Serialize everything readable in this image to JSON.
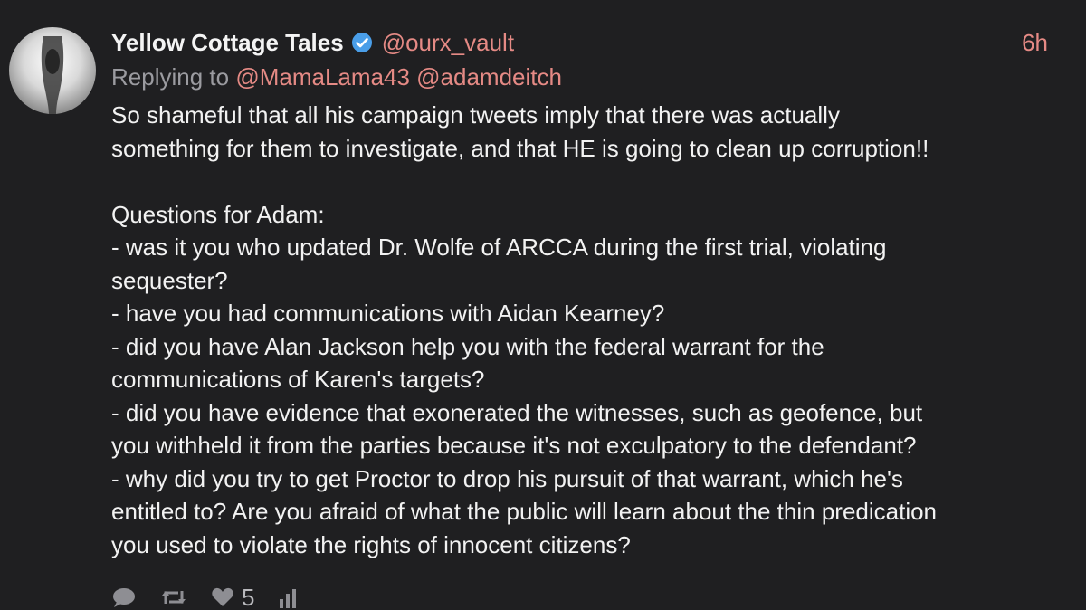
{
  "tweet": {
    "display_name": "Yellow Cottage Tales",
    "handle": "@ourx_vault",
    "time": "6h",
    "replying_to_label": "Replying to",
    "replying_to": [
      "@MamaLama43",
      "@adamdeitch"
    ],
    "lines": [
      "So shameful that all his campaign tweets imply that there was actually",
      "something for them to investigate, and that HE is going to clean up corruption!!",
      "",
      "Questions for Adam:",
      "- was it you who updated Dr. Wolfe of ARCCA during the first trial, violating",
      "sequester?",
      "- have you had communications with Aidan Kearney?",
      "- did you have Alan Jackson help you with the federal warrant for the",
      "communications of Karen's targets?",
      "- did you have evidence that exonerated the witnesses, such as geofence, but",
      "you withheld it from the parties because it's not exculpatory to the defendant?",
      "- why did you try to get Proctor to drop his pursuit of that warrant, which he's",
      "entitled to? Are you afraid of what the public will learn about the thin predication",
      "you used to violate the rights of innocent citizens?"
    ],
    "like_count": "5"
  },
  "icons": {
    "verified": "verified-badge-icon",
    "reply": "reply-icon",
    "retweet": "retweet-icon",
    "like": "heart-icon",
    "stats": "stats-icon"
  },
  "colors": {
    "background": "#1f1f21",
    "accent": "#e58a85",
    "verified": "#4a9ee8",
    "muted": "#9b9ba0"
  }
}
